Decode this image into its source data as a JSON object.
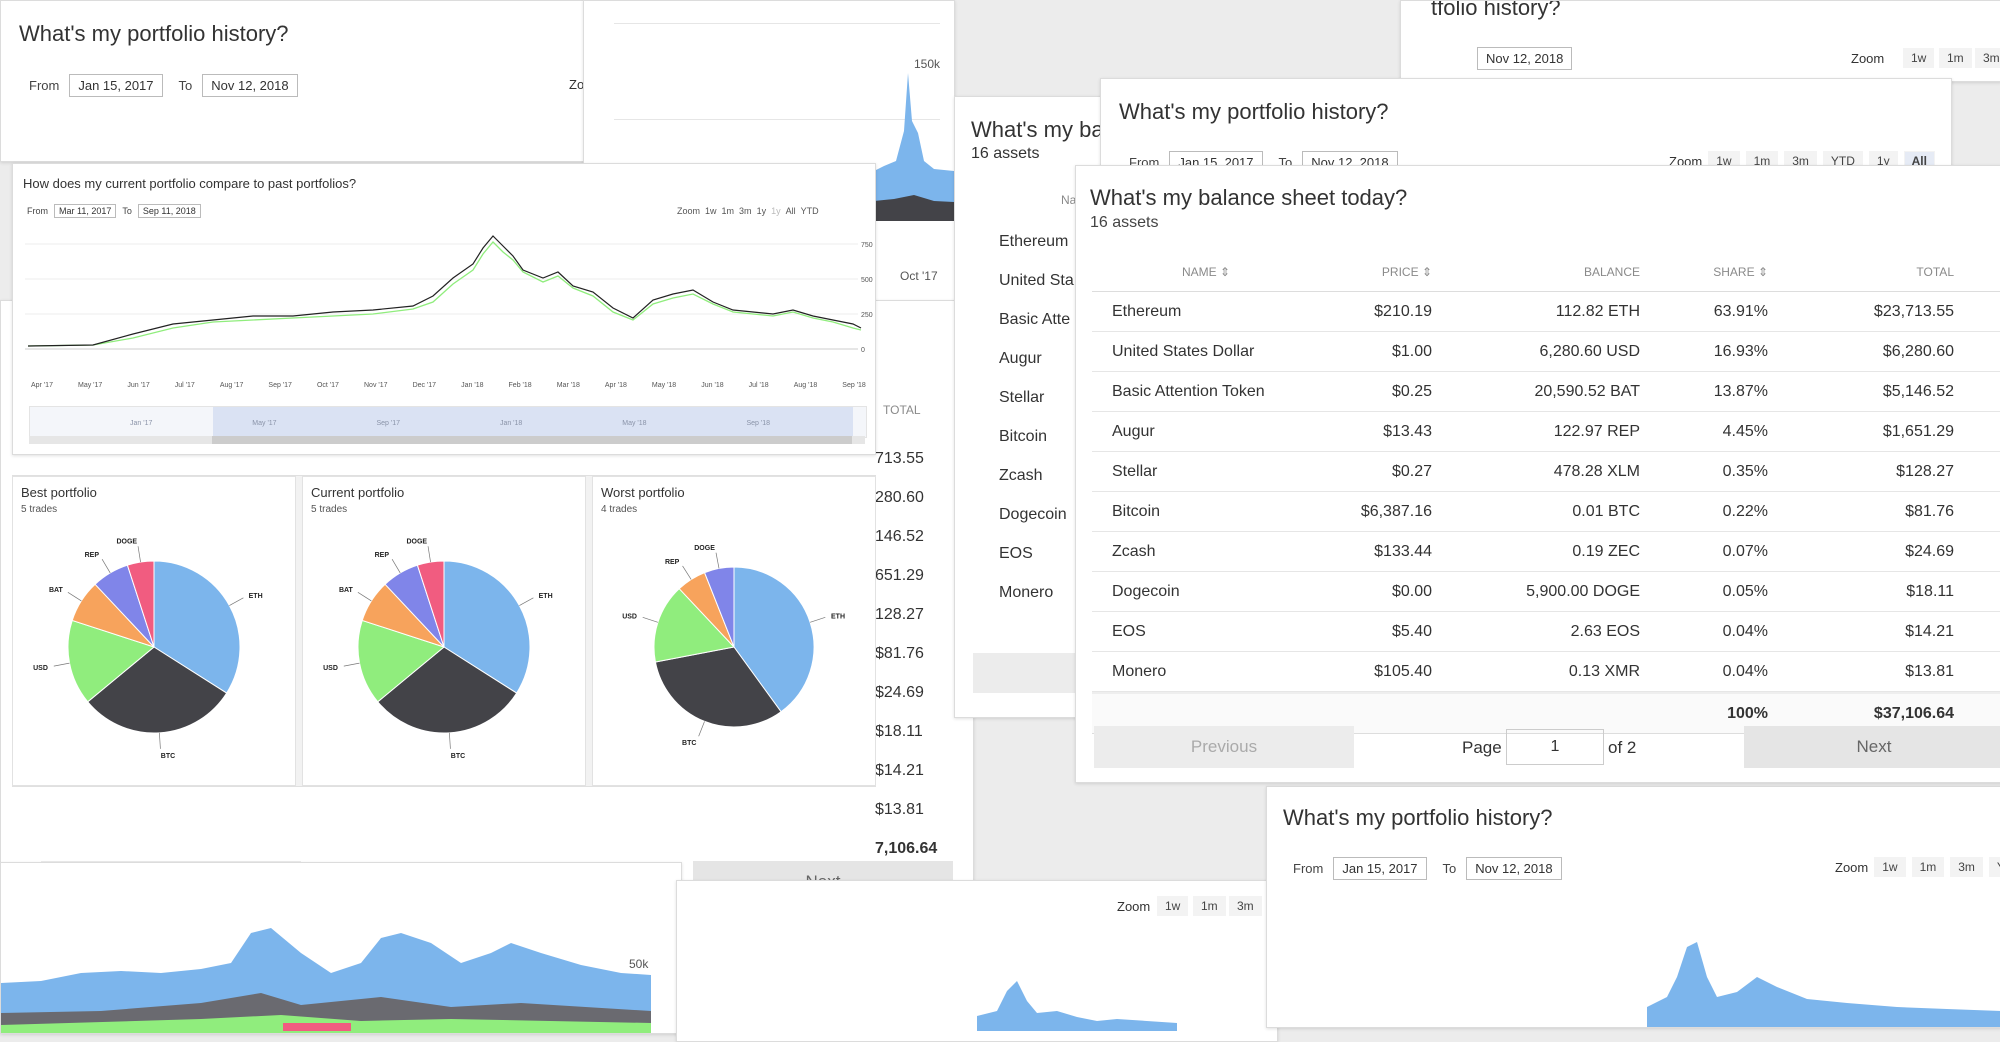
{
  "history_title": "What's my portfolio history?",
  "balance_title_partial": "What's my ba",
  "portfolio_title_partial": "tfolio history?",
  "range": {
    "from_label": "From",
    "to_label": "To",
    "from": "Jan 15, 2017",
    "to": "Nov 12, 2018"
  },
  "zoom": {
    "label": "Zoom",
    "options": [
      "1w",
      "1m",
      "3m",
      "YTD",
      "1y",
      "All"
    ],
    "active": "All"
  },
  "history_axis": {
    "y_150k": "150k",
    "y_50k": "50k",
    "oct17": "Oct '17",
    "jul17": "Jul '17",
    "jan18": "Jan '18",
    "jul18": "Jul '18"
  },
  "compare": {
    "title": "How does my current portfolio compare to past portfolios?",
    "from": "Mar 11, 2017",
    "to": "Sep 11, 2018",
    "zoom_options": [
      "1w",
      "1m",
      "3m",
      "1y",
      "1y",
      "All",
      "YTD"
    ],
    "y_ticks": [
      "750",
      "500",
      "250",
      "0"
    ],
    "x_ticks": [
      "Apr '17",
      "May '17",
      "Jun '17",
      "Jul '17",
      "Aug '17",
      "Sep '17",
      "Oct '17",
      "Nov '17",
      "Dec '17",
      "Jan '18",
      "Feb '18",
      "Mar '18",
      "Apr '18",
      "May '18",
      "Jun '18",
      "Jul '18",
      "Aug '18",
      "Sep '18"
    ],
    "nav_ticks": [
      "Jan '17",
      "May '17",
      "Sep '17",
      "Jan '18",
      "May '18",
      "Sep '18"
    ]
  },
  "pies": [
    {
      "title": "Best portfolio",
      "sub": "5 trades",
      "slices": [
        {
          "label": "ETH",
          "value": 34,
          "color": "#7cb5ec"
        },
        {
          "label": "BTC",
          "value": 30,
          "color": "#434348"
        },
        {
          "label": "USD",
          "value": 16,
          "color": "#90ed7d"
        },
        {
          "label": "BAT",
          "value": 8,
          "color": "#f7a35c"
        },
        {
          "label": "REP",
          "value": 7,
          "color": "#8085e9"
        },
        {
          "label": "DOGE",
          "value": 5,
          "color": "#f15c80"
        }
      ]
    },
    {
      "title": "Current portfolio",
      "sub": "5 trades",
      "slices": [
        {
          "label": "ETH",
          "value": 34,
          "color": "#7cb5ec"
        },
        {
          "label": "BTC",
          "value": 30,
          "color": "#434348"
        },
        {
          "label": "USD",
          "value": 16,
          "color": "#90ed7d"
        },
        {
          "label": "BAT",
          "value": 8,
          "color": "#f7a35c"
        },
        {
          "label": "REP",
          "value": 7,
          "color": "#8085e9"
        },
        {
          "label": "DOGE",
          "value": 5,
          "color": "#f15c80"
        }
      ]
    },
    {
      "title": "Worst portfolio",
      "sub": "4 trades",
      "slices": [
        {
          "label": "ETH",
          "value": 40,
          "color": "#7cb5ec"
        },
        {
          "label": "BTC",
          "value": 32,
          "color": "#434348"
        },
        {
          "label": "USD",
          "value": 16,
          "color": "#90ed7d"
        },
        {
          "label": "REP",
          "value": 6,
          "color": "#f7a35c"
        },
        {
          "label": "DOGE",
          "value": 6,
          "color": "#8085e9"
        }
      ]
    }
  ],
  "balance": {
    "title": "What's my balance sheet today?",
    "count": "16 assets",
    "headers": {
      "name": "NAME",
      "price": "PRICE",
      "balance": "BALANCE",
      "share": "SHARE",
      "total": "TOTAL"
    },
    "rows": [
      {
        "name": "Ethereum",
        "price": "$210.19",
        "balance": "112.82 ETH",
        "share": "63.91%",
        "total": "$23,713.55"
      },
      {
        "name": "United States Dollar",
        "price": "$1.00",
        "balance": "6,280.60 USD",
        "share": "16.93%",
        "total": "$6,280.60"
      },
      {
        "name": "Basic Attention Token",
        "price": "$0.25",
        "balance": "20,590.52 BAT",
        "share": "13.87%",
        "total": "$5,146.52"
      },
      {
        "name": "Augur",
        "price": "$13.43",
        "balance": "122.97 REP",
        "share": "4.45%",
        "total": "$1,651.29"
      },
      {
        "name": "Stellar",
        "price": "$0.27",
        "balance": "478.28 XLM",
        "share": "0.35%",
        "total": "$128.27"
      },
      {
        "name": "Bitcoin",
        "price": "$6,387.16",
        "balance": "0.01 BTC",
        "share": "0.22%",
        "total": "$81.76"
      },
      {
        "name": "Zcash",
        "price": "$133.44",
        "balance": "0.19 ZEC",
        "share": "0.07%",
        "total": "$24.69"
      },
      {
        "name": "Dogecoin",
        "price": "$0.00",
        "balance": "5,900.00 DOGE",
        "share": "0.05%",
        "total": "$18.11"
      },
      {
        "name": "EOS",
        "price": "$5.40",
        "balance": "2.63 EOS",
        "share": "0.04%",
        "total": "$14.21"
      },
      {
        "name": "Monero",
        "price": "$105.40",
        "balance": "0.13 XMR",
        "share": "0.04%",
        "total": "$13.81"
      }
    ],
    "footer": {
      "share": "100%",
      "total": "$37,106.64"
    },
    "bg_totals": [
      "713.55",
      "280.60",
      "146.52",
      "651.29",
      "128.27",
      "$81.76",
      "$24.69",
      "$18.11",
      "$14.21",
      "$13.81",
      "7,106.64"
    ],
    "bg_total_header": "TOTAL",
    "mid_names": [
      "Ethereum",
      "United Sta",
      "Basic Atte",
      "Augur",
      "Stellar",
      "Bitcoin",
      "Zcash",
      "Dogecoin",
      "EOS",
      "Monero"
    ],
    "mid_na": "Na"
  },
  "pager": {
    "previous": "Previous",
    "page": "Page",
    "value": "1",
    "of": "of 2",
    "next": "Next"
  }
}
